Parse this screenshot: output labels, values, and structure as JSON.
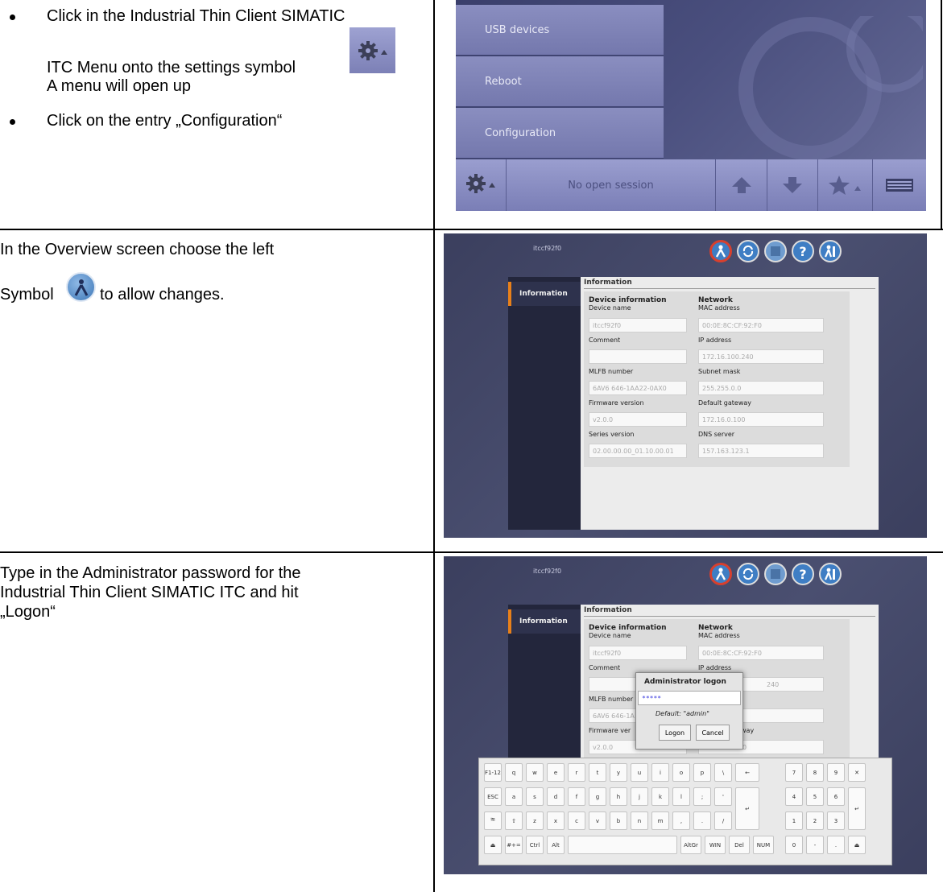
{
  "rows": [
    {
      "bullets": [
        "Click in the Industrial Thin Client SIMATIC",
        "Click on the entry „Configuration“"
      ],
      "line2": "ITC Menu onto the settings symbol",
      "line3": "A menu will open up"
    },
    {
      "line1": "In the Overview screen choose the left",
      "line2a": "Symbol",
      "line2b": "to allow changes."
    },
    {
      "line1": "Type in the Administrator password for the",
      "line2": "Industrial Thin Client SIMATIC ITC and hit",
      "line3": "„Logon“"
    }
  ],
  "menu": {
    "items": [
      "USB devices",
      "Reboot",
      "Configuration"
    ],
    "session": "No open session"
  },
  "device": {
    "hostname": "itccf92f0",
    "side_item": "Information",
    "panel_title": "Information",
    "group_device": "Device information",
    "group_network": "Network",
    "fields_left": [
      {
        "label": "Device name",
        "value": "itccf92f0"
      },
      {
        "label": "Comment",
        "value": ""
      },
      {
        "label": "MLFB number",
        "value": "6AV6 646-1AA22-0AX0"
      },
      {
        "label": "Firmware version",
        "value": "v2.0.0"
      },
      {
        "label": "Series version",
        "value": "02.00.00.00_01.10.00.01"
      }
    ],
    "fields_right": [
      {
        "label": "MAC address",
        "value": "00:0E:8C:CF:92:F0"
      },
      {
        "label": "IP address",
        "value": "172.16.100.240"
      },
      {
        "label": "Subnet mask",
        "value": "255.255.0.0"
      },
      {
        "label": "Default gateway",
        "value": "172.16.0.100"
      },
      {
        "label": "DNS server",
        "value": "157.163.123.1"
      }
    ]
  },
  "dialog": {
    "title": "Administrator logon",
    "password": "*****",
    "hint": "Default: \"admin\"",
    "logon": "Logon",
    "cancel": "Cancel"
  },
  "shot3_partial": {
    "mlfb_partial": "MLFB number",
    "mlfb_value_partial": "6AV6 646-1A",
    "fw_partial": "Firmware ver",
    "ip_partial": "240",
    "gw_partial": "way",
    "gw_value_partial": "0"
  },
  "keyboard": {
    "row1": [
      "F1-12",
      "q",
      "w",
      "e",
      "r",
      "t",
      "y",
      "u",
      "i",
      "o",
      "p",
      "\\",
      "←"
    ],
    "row2": [
      "ESC",
      "a",
      "s",
      "d",
      "f",
      "g",
      "h",
      "j",
      "k",
      "l",
      ";",
      "'"
    ],
    "row3": [
      "⭾",
      "⇧",
      "z",
      "x",
      "c",
      "v",
      "b",
      "n",
      "m",
      ",",
      ".",
      "/"
    ],
    "row4": [
      "⏏",
      "#+=",
      "Ctrl",
      "Alt",
      "",
      "AltGr",
      "WIN",
      "Del",
      "NUM"
    ],
    "numpad": [
      [
        "7",
        "8",
        "9",
        "✕"
      ],
      [
        "4",
        "5",
        "6"
      ],
      [
        "1",
        "2",
        "3"
      ],
      [
        "0",
        "-",
        ".",
        "⏏"
      ]
    ],
    "enter": "↵"
  }
}
